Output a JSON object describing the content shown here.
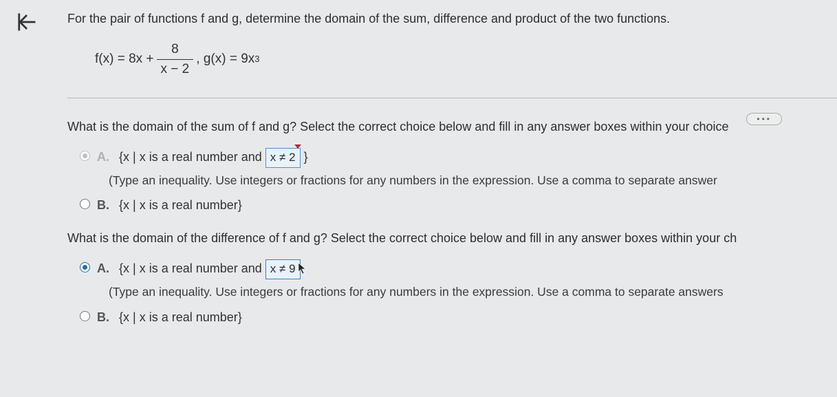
{
  "problem": {
    "intro": "For the pair of functions f and g, determine the domain of the sum, difference and product of the two functions.",
    "f_left": "f(x) = 8x +",
    "frac_num": "8",
    "frac_den": "x − 2",
    "g_part": ", g(x) = 9x",
    "g_exp": "3"
  },
  "ellipsis": "•••",
  "q1": {
    "prompt": "What is the domain of the sum of f and g? Select the correct choice below and fill in any answer boxes within your choice",
    "a_label": "A.",
    "a_pre": "{x | x is a real number and ",
    "a_answer": "x ≠ 2",
    "a_post": " }",
    "hint": "(Type an inequality. Use integers or fractions for any numbers in the expression. Use a comma to separate answer",
    "b_label": "B.",
    "b_text": "{x | x is a real number}"
  },
  "q2": {
    "prompt": "What is the domain of the difference of f and g? Select the correct choice below and fill in any answer boxes within your ch",
    "a_label": "A.",
    "a_pre": "{x | x is a real number and ",
    "a_answer": "x ≠ 9",
    "hint": "(Type an inequality. Use integers or fractions for any numbers in the expression. Use a comma to separate answers",
    "b_label": "B.",
    "b_text": "{x | x is a real number}"
  }
}
